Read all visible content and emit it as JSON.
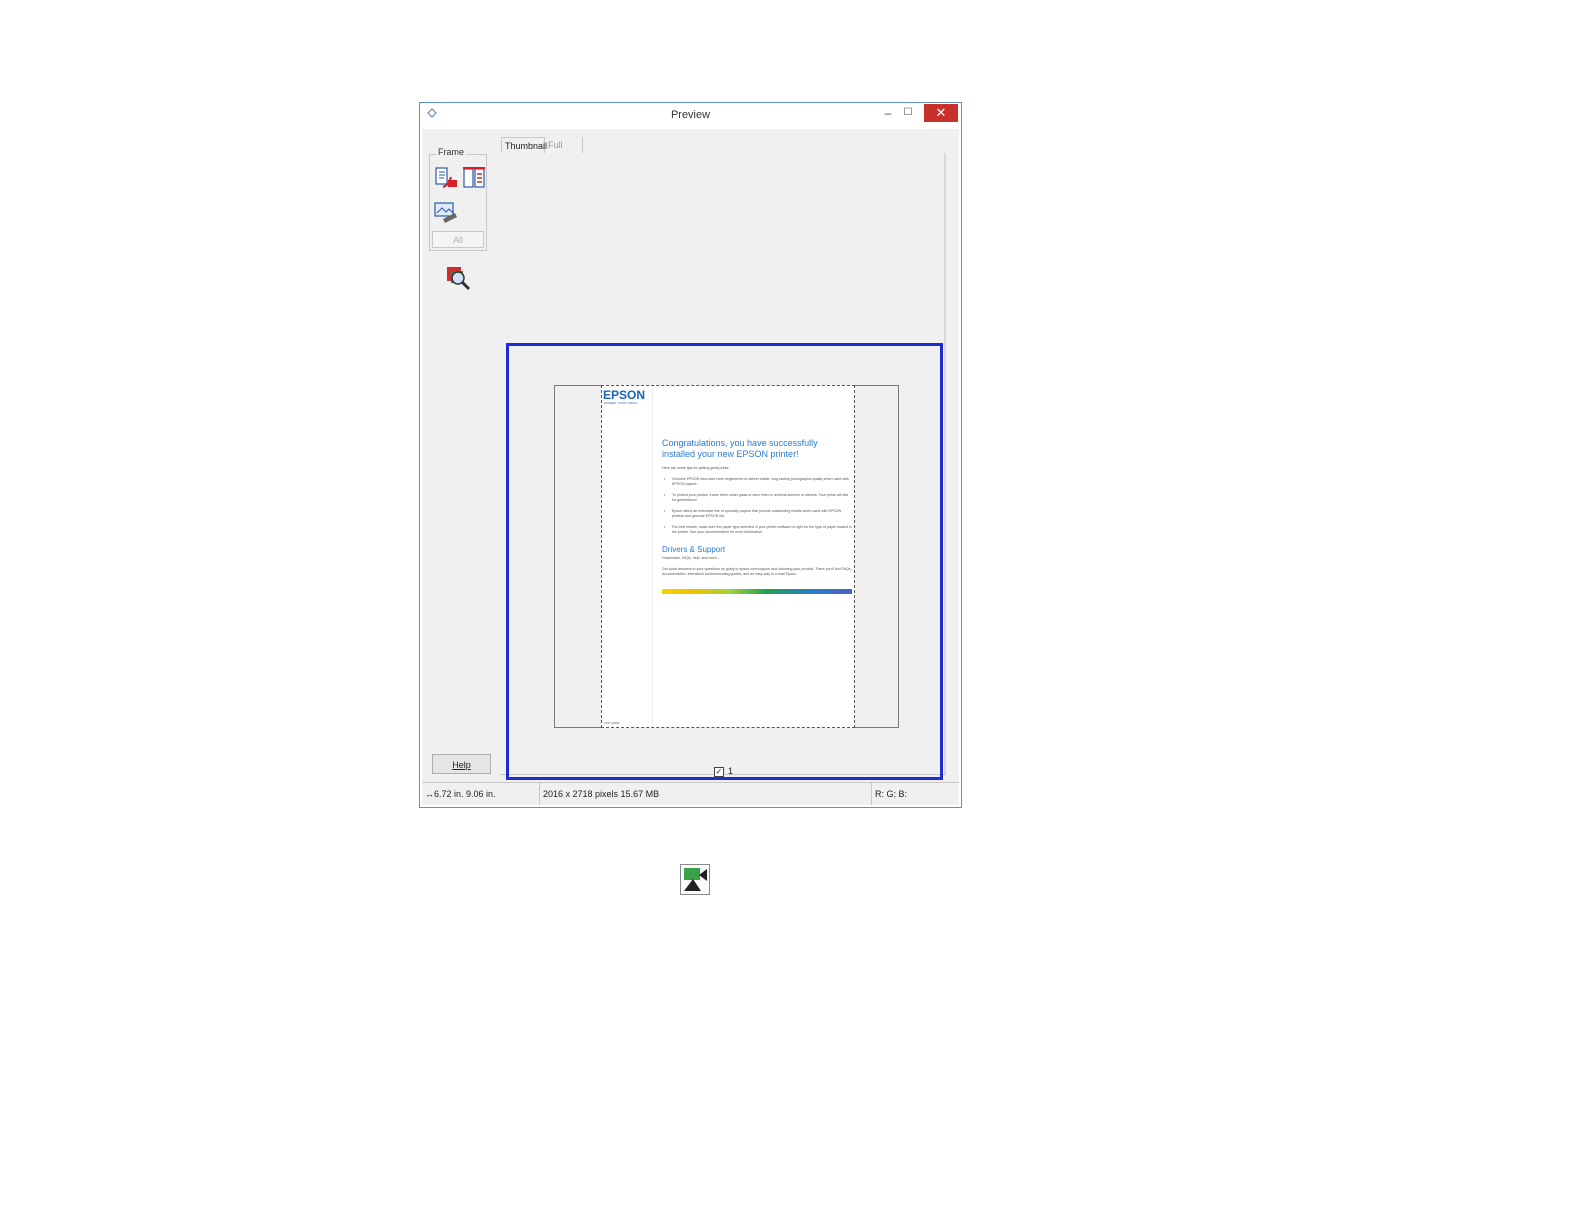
{
  "window": {
    "title": "Preview",
    "minimize_glyph": "–",
    "maximize_glyph": "☐",
    "close_glyph": "✕"
  },
  "toolbar": {
    "frame_label": "Frame",
    "all_button": "All",
    "help_button": "Help",
    "icons": [
      "auto-locate-icon",
      "select-all-frames-icon",
      "create-marquee-icon",
      "zoom-icon"
    ]
  },
  "tabs": [
    {
      "label": "Thumbnail",
      "active": true
    },
    {
      "label": "Full Size",
      "active": false
    }
  ],
  "thumbnail": {
    "selected": true,
    "index_label": "1",
    "check_glyph": "✓",
    "document": {
      "logo": "EPSON",
      "logo_tagline": "EXCEED YOUR VISION",
      "heading": "Congratulations, you have successfully installed your new EPSON printer!",
      "intro": "Here are some tips for getting great prints:",
      "tips": [
        "Genuine EPSON inks have been engineered to deliver stable, long-lasting photographic quality when used with EPSON papers.",
        "To protect your photos, frame them under glass or store them in archival sleeves or albums. Your prints will last for generations!",
        "Epson offers an extensive line of specialty papers that provide outstanding results when used with EPSON printers and genuine EPSON ink.",
        "For best results, make sure the paper type selected in your printer software is right for the type of paper loaded in the printer. See your documentation for more information."
      ],
      "support_heading": "Drivers & Support",
      "support_sub": "Downloads, FAQs, help, and more...",
      "support_text": "Get quick answers to your questions by going to epson.com/support and choosing your product. There you'll find FAQs, documentation, interactive troubleshooting guides, and an easy way to e-mail Epson.",
      "footer": "CPD-00000"
    }
  },
  "statusbar": {
    "dimensions": "6.72 in.  9.06 in.",
    "pixels": "2016 x 2718 pixels 15.67 MB",
    "rgb": "R: G: B:"
  },
  "colors": {
    "selection_border": "#1e2cd6",
    "close_button": "#c7312a",
    "epson_blue": "#1a64b8"
  }
}
